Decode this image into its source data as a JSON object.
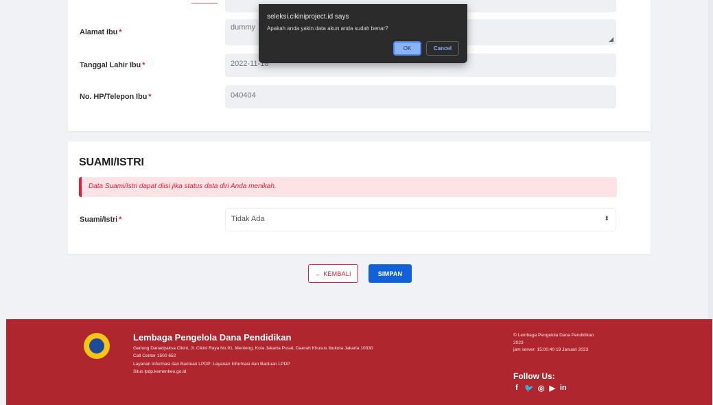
{
  "form": {
    "alamat_ibu": {
      "label": "Alamat Ibu",
      "value": "dummy"
    },
    "tanggal_lahir_ibu": {
      "label": "Tanggal Lahir Ibu",
      "value": "2022-11-18"
    },
    "telepon_ibu": {
      "label": "No. HP/Telepon Ibu",
      "value": "040404"
    },
    "required_mark": "*"
  },
  "spouse": {
    "title": "SUAMI/ISTRI",
    "alert": "Data Suami/Istri dapat diisi jika status data diri Anda menikah.",
    "label": "Suami/Istri",
    "selected": "Tidak Ada"
  },
  "buttons": {
    "back": "← KEMBALI",
    "save": "SIMPAN"
  },
  "dialog": {
    "title": "seleksi.cikiniproject.id says",
    "message": "Apakah anda yakin data akun anda sudah benar?",
    "ok": "OK",
    "cancel": "Cancel"
  },
  "footer": {
    "org_name": "Lembaga Pengelola Dana Pendidikan",
    "address": "Gedung Danadyaksa Cikini, Jl. Cikini Raya No.91, Menteng, Kota Jakarta Pusat, Daerah Khusus Ibukota Jakarta 10330",
    "call_center": "Call Center 1500 652",
    "layanan": "Layanan Informasi dan Bantuan LPDP: Layanan Informasi dan Bantuan LPDP",
    "situs": "Situs lpdp.kemenkeu.go.id",
    "copyright": "© Lembaga Pengelola Dana Pendidikan 2023",
    "server_time": "jam server: 15:00:40 19 Januari 2023",
    "follow_us": "Follow Us:",
    "socials": {
      "facebook": "f",
      "twitter": "🐦",
      "instagram": "◎",
      "youtube": "▶",
      "linkedin": "in"
    }
  },
  "colors": {
    "accent_red": "#b0262e",
    "primary_blue": "#1261d6",
    "alert_red": "#e01e37"
  }
}
